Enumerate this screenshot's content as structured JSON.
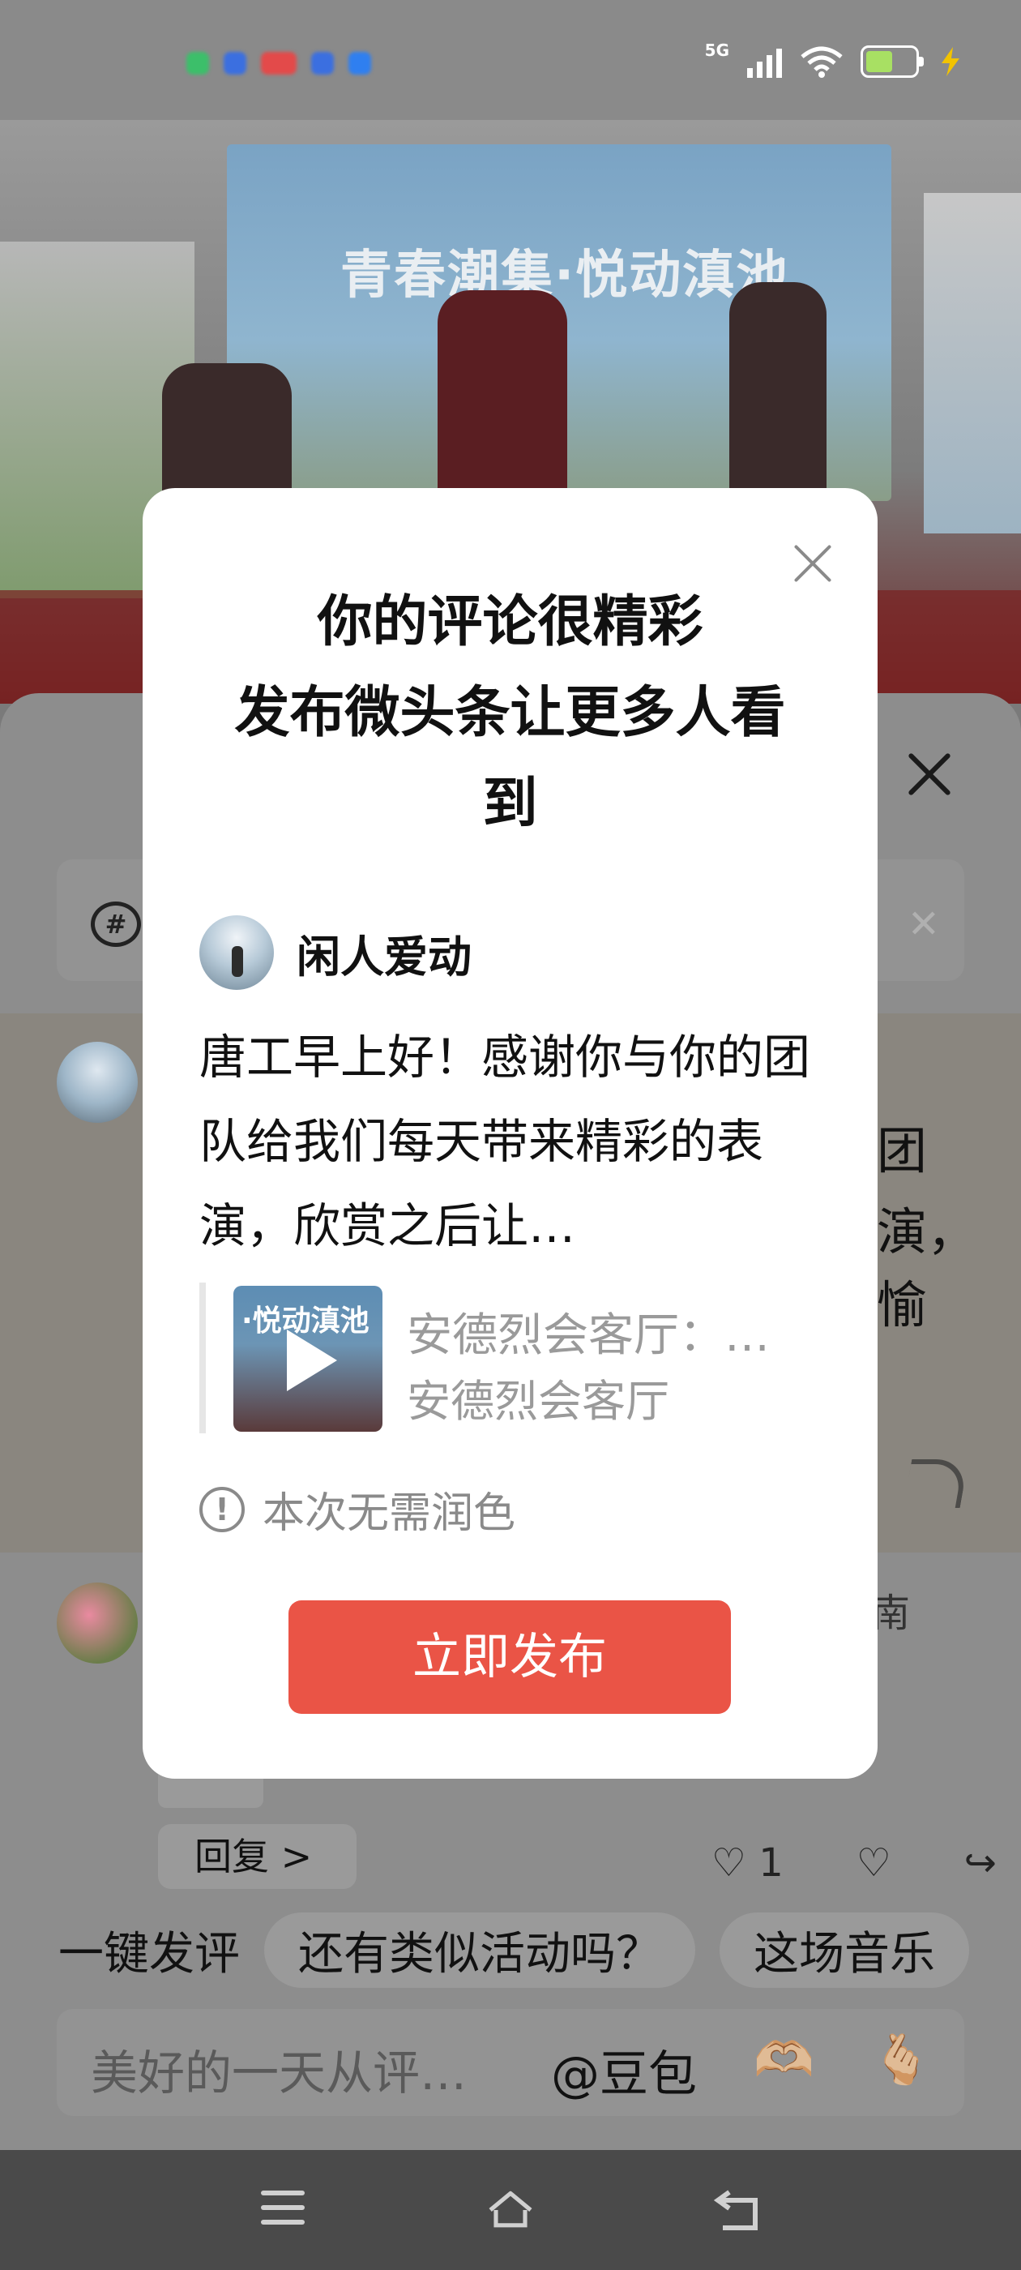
{
  "status_bar": {
    "network": "5G",
    "colors": [
      "#3cbf6a",
      "#3b6fe0",
      "#e34a4a",
      "#3b6fe0",
      "#2f7ff0"
    ]
  },
  "photo": {
    "banner_title": "青春潮集·悦动滇池"
  },
  "modal": {
    "title": "你的评论很精彩\n发布微头条让更多人看到",
    "author_name": "闲人爱动",
    "comment": "唐工早上好！感谢你与你的团队给我们每天带来精彩的表演，欣赏之后让…",
    "quote": {
      "thumb_text": "·悦动滇池",
      "title": "安德烈会客厅：…",
      "source": "安德烈会客厅"
    },
    "no_polish_text": "本次无需润色",
    "publish_label": "立即发布",
    "accent_color": "#ea5446"
  },
  "background": {
    "topic_icon": "#",
    "right_snippets": [
      "团",
      "演，",
      "愉"
    ],
    "right_top_text": "南",
    "reply_label": "回复 >",
    "like_count": "1"
  },
  "quick_comment": {
    "label": "一键发评",
    "chips": [
      "还有类似活动吗？",
      "这场音乐"
    ]
  },
  "input": {
    "placeholder": "美好的一天从评…",
    "mention": "@豆包",
    "emojis": [
      "🫶🏼",
      "🫰🏼"
    ]
  }
}
